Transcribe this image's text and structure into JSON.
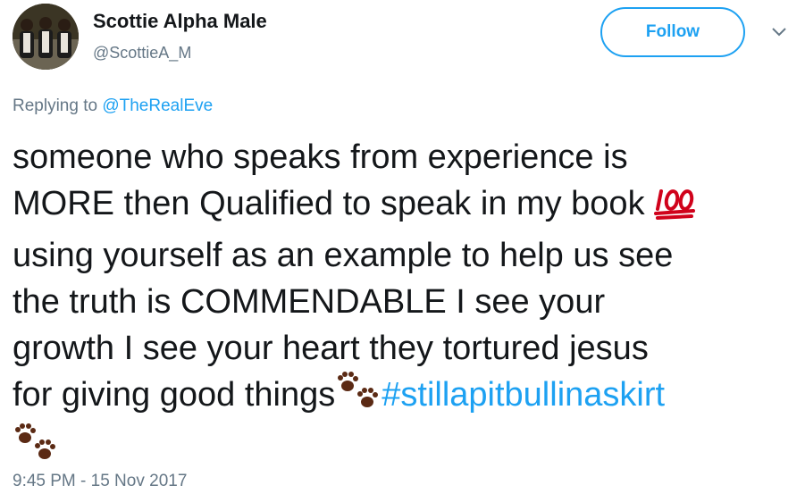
{
  "author": {
    "name": "Scottie Alpha Male",
    "handle": "@ScottieA_M",
    "avatar_icon": "profile-photo"
  },
  "actions": {
    "follow_label": "Follow",
    "menu_icon": "chevron-down-icon"
  },
  "reply": {
    "prefix": "Replying to ",
    "mention": "@TheRealEve"
  },
  "tweet": {
    "lines": [
      "someone who speaks from experience is",
      "MORE then Qualified to speak in my book ",
      "using yourself as an example to help us see",
      "the truth is COMMENDABLE  I see your",
      "growth I see your heart they tortured jesus",
      "for giving good things"
    ],
    "hashtag": "#stillapitbullinaskirt",
    "emojis": [
      "hundred-points-emoji",
      "paw-prints-emoji",
      "paw-prints-emoji"
    ]
  },
  "timestamp": "9:45 PM - 15 Nov 2017",
  "colors": {
    "accent": "#1da1f2",
    "muted": "#657786",
    "text": "#14171a",
    "emoji_red": "#d0021b",
    "emoji_brown": "#5b2a14"
  }
}
